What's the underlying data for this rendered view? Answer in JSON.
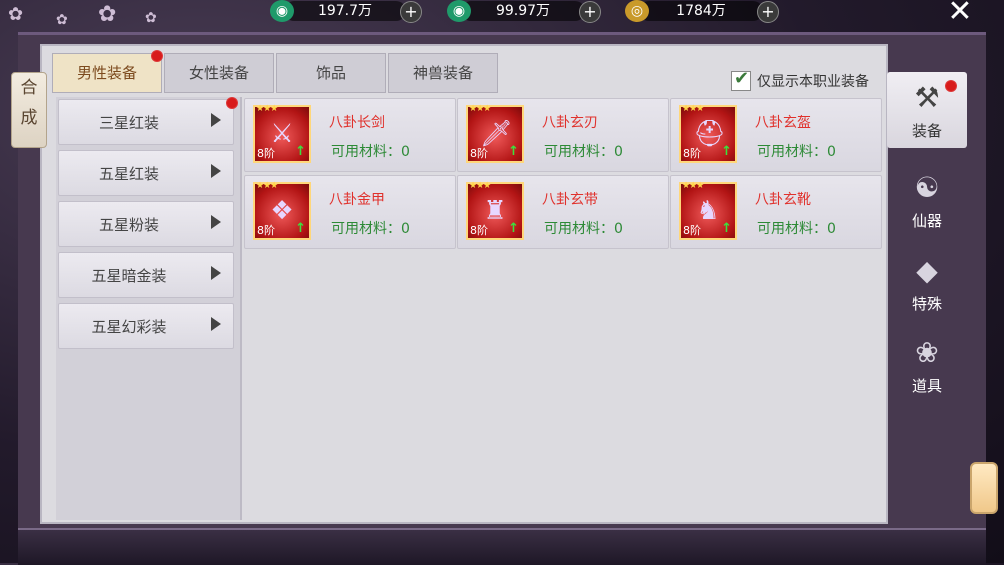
{
  "currencies": [
    {
      "icon": "jade-coin-icon",
      "value": "197.7万"
    },
    {
      "icon": "locked-jade-icon",
      "value": "99.97万"
    },
    {
      "icon": "gold-coin-icon",
      "value": "1784万"
    }
  ],
  "side_tab": {
    "chars": [
      "合",
      "成"
    ]
  },
  "tabs": [
    "男性装备",
    "女性装备",
    "饰品",
    "神兽装备"
  ],
  "active_tab": 0,
  "filter": {
    "label": "仅显示本职业装备",
    "checked": true
  },
  "categories": [
    "三星红装",
    "五星红装",
    "五星粉装",
    "五星暗金装",
    "五星幻彩装"
  ],
  "items": [
    {
      "name": "八卦长剑",
      "material": "可用材料：0",
      "level": "8阶",
      "icon": "sword-icon"
    },
    {
      "name": "八卦玄刃",
      "material": "可用材料：0",
      "level": "8阶",
      "icon": "blade-icon"
    },
    {
      "name": "八卦玄盔",
      "material": "可用材料：0",
      "level": "8阶",
      "icon": "helmet-icon"
    },
    {
      "name": "八卦金甲",
      "material": "可用材料：0",
      "level": "8阶",
      "icon": "armor-icon"
    },
    {
      "name": "八卦玄带",
      "material": "可用材料：0",
      "level": "8阶",
      "icon": "belt-icon"
    },
    {
      "name": "八卦玄靴",
      "material": "可用材料：0",
      "level": "8阶",
      "icon": "boots-icon"
    }
  ],
  "right_nav": [
    {
      "label": "装备",
      "icon": "hammer-icon"
    },
    {
      "label": "仙器",
      "icon": "artifact-icon"
    },
    {
      "label": "特殊",
      "icon": "gem-icon"
    },
    {
      "label": "道具",
      "icon": "scroll-icon"
    }
  ],
  "colors": {
    "item_name": "#e0312c",
    "material": "#2d8a36",
    "notify_dot": "#d81b1b"
  }
}
